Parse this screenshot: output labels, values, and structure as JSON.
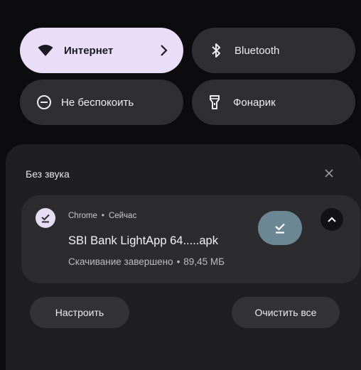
{
  "quick_settings": {
    "internet": {
      "label": "Интернет",
      "icon": "wifi-icon",
      "state": "on"
    },
    "bluetooth": {
      "label": "Bluetooth",
      "icon": "bluetooth-icon",
      "state": "off"
    },
    "dnd": {
      "label": "Не беспокоить",
      "icon": "do-not-disturb-icon",
      "state": "off"
    },
    "flashlight": {
      "label": "Фонарик",
      "icon": "flashlight-icon",
      "state": "off"
    }
  },
  "notifications": {
    "section_title": "Без звука",
    "items": [
      {
        "app": "Chrome",
        "separator": "•",
        "time": "Сейчас",
        "title": "SBI Bank LightApp 64.....apk",
        "status": "Скачивание завершено",
        "sep2": "•",
        "size": "89,45 МБ"
      }
    ]
  },
  "actions": {
    "manage_label": "Настроить",
    "clear_all_label": "Очистить все"
  },
  "colors": {
    "background": "#0c0c0e",
    "tile_active": "#e9ddf7",
    "tile_inactive": "#2f2f31",
    "shade": "#1f1f21",
    "card": "#2c2c2e",
    "download_button": "#6c8794"
  }
}
